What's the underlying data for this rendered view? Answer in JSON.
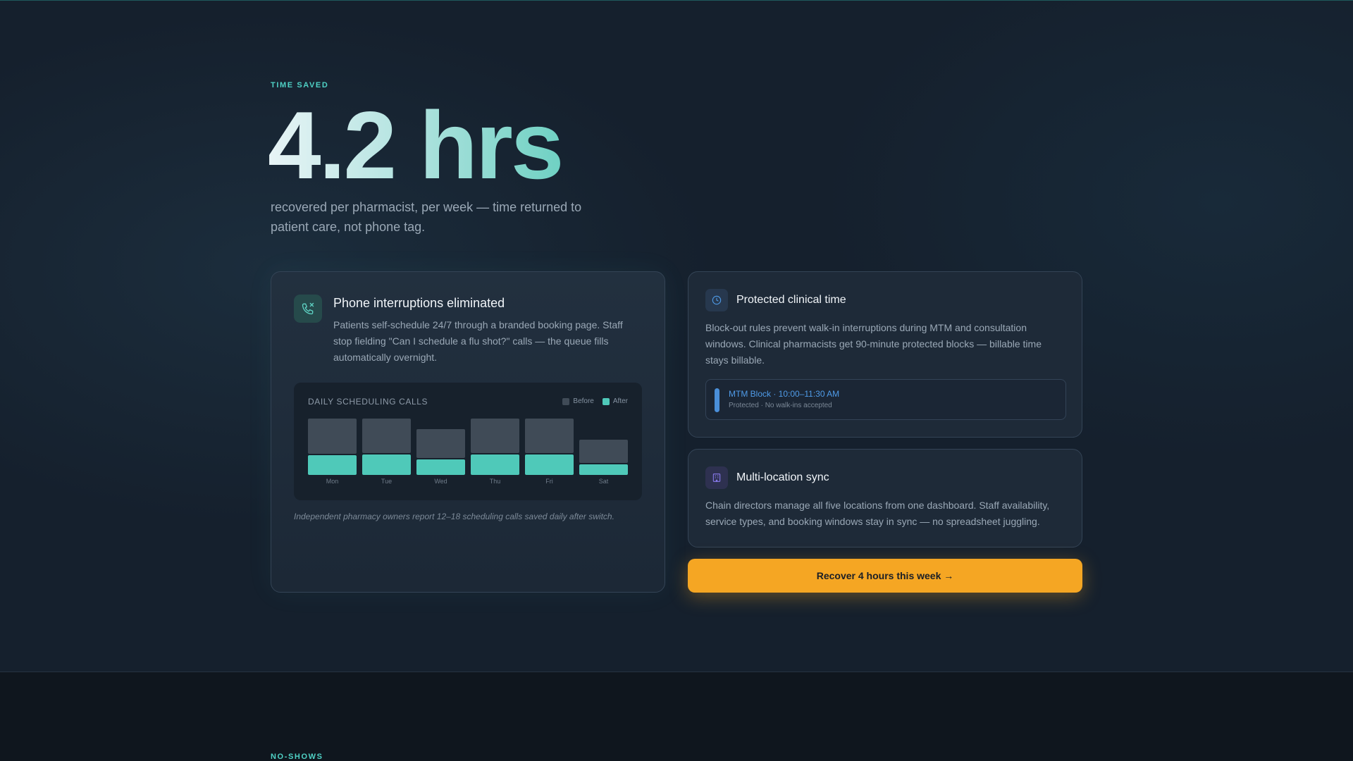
{
  "section1": {
    "eyebrow": "TIME SAVED",
    "value": "4.2 hrs",
    "subtitle": "recovered per pharmacist, per week — time returned to patient care, not phone tag."
  },
  "card_phone": {
    "icon": "phone-off-icon",
    "title": "Phone interruptions eliminated",
    "text": "Patients self-schedule 24/7 through a branded booking page. Staff stop fielding \"Can I schedule a flu shot?\" calls — the queue fills automatically overnight.",
    "footnote": "Independent pharmacy owners report 12–18 scheduling calls saved daily after switch."
  },
  "chart_data": {
    "type": "bar",
    "title": "DAILY SCHEDULING CALLS",
    "categories": [
      "Mon",
      "Tue",
      "Wed",
      "Thu",
      "Fri",
      "Sat"
    ],
    "series": [
      {
        "name": "Before",
        "values": [
          80,
          80,
          65,
          80,
          80,
          50
        ],
        "color": "#404b57"
      },
      {
        "name": "After",
        "values": [
          28,
          29,
          22,
          29,
          29,
          15
        ],
        "color": "#4fc9b9"
      }
    ],
    "ylim": [
      0,
      80
    ],
    "grid": false,
    "legend": "top-right"
  },
  "card_clinical": {
    "icon": "clock-icon",
    "title": "Protected clinical time",
    "text": "Block-out rules prevent walk-in interruptions during MTM and consultation windows. Clinical pharmacists get 90-minute protected blocks — billable time stays billable.",
    "block_title": "MTM Block · 10:00–11:30 AM",
    "block_sub": "Protected · No walk-ins accepted"
  },
  "card_sync": {
    "icon": "building-icon",
    "title": "Multi-location sync",
    "text": "Chain directors manage all five locations from one dashboard. Staff availability, service types, and booking windows stay in sync — no spreadsheet juggling."
  },
  "cta": {
    "label": "Recover 4 hours this week →"
  },
  "section2": {
    "eyebrow": "NO-SHOWS"
  },
  "colors": {
    "accent": "#4fd1c5",
    "cta": "#f5a623",
    "block_blue": "#4a8fd9"
  }
}
